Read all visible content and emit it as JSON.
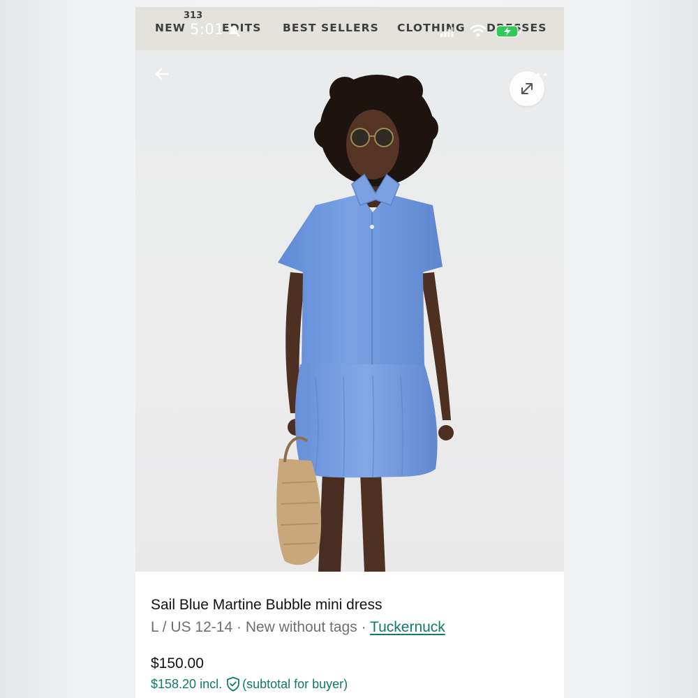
{
  "status_bar": {
    "time": "5:01"
  },
  "nav": {
    "links": [
      {
        "label": "NEW"
      },
      {
        "label": "EDITS"
      },
      {
        "label": "BEST SELLERS"
      },
      {
        "label": "CLOTHING"
      },
      {
        "label": "DRESSES"
      }
    ],
    "count_badge": "313"
  },
  "icons": {
    "back": "arrow-left-icon",
    "expand": "expand-arrows-icon",
    "more": "more-dots-icon",
    "shield": "shield-check-icon"
  },
  "product": {
    "title": "Sail Blue Martine Bubble mini dress",
    "size": "L / US 12-14",
    "condition": "New without tags",
    "separator": "·",
    "brand": "Tuckernuck",
    "price": "$150.00",
    "price_incl": "$158.20 incl.",
    "price_incl_note": "(subtotal for buyer)"
  },
  "colors": {
    "accent_green": "#0f7a66",
    "dress_blue": "#6b95dc"
  }
}
